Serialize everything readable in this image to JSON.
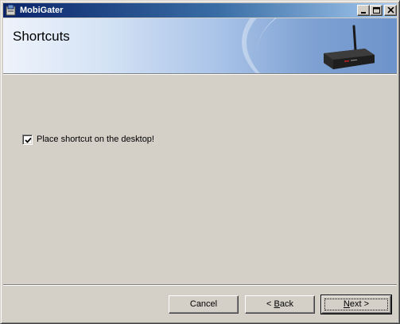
{
  "window": {
    "title": "MobiGater"
  },
  "banner": {
    "title": "Shortcuts"
  },
  "options": {
    "desktop_shortcut_label": "Place shortcut on the desktop!",
    "desktop_shortcut_checked": true
  },
  "buttons": {
    "cancel": "Cancel",
    "back_arrow": "<",
    "back_accel": "B",
    "back_rest": "ack",
    "next_accel": "N",
    "next_rest": "ext",
    "next_arrow": ">"
  },
  "icons": {
    "app": "app-installer-icon",
    "minimize": "minimize-icon",
    "maximize": "maximize-icon",
    "close": "close-icon",
    "router": "router-device-image"
  }
}
